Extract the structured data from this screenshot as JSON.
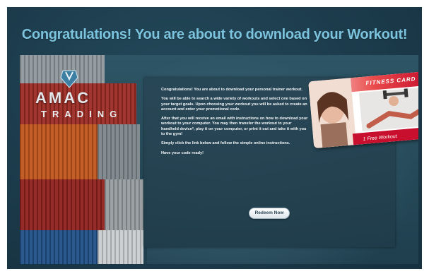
{
  "page": {
    "headline": "Congratulations! You are about to download your Workout!"
  },
  "logo": {
    "name": "AMAC",
    "subtitle": "TRADING"
  },
  "card": {
    "title": "FITNESS CARD",
    "footer": "1 Free Workout"
  },
  "content": {
    "paragraphs": [
      "Congratulations! You are about to download your personal trainer workout.",
      "You will be able to search a wide variety of workouts and select one based on your target goals. Upon choosing your workout you will be asked to create an account and enter your promotional code.",
      "After that you will receive an email with instructions on how to download your workout to your computer. You may then transfer the workout to your handheld device*, play it on your computer, or print it out and take it with you to the gym!",
      "Simply click the link below and follow the simple online instructions.",
      "Have your code ready!"
    ],
    "redeem_label": "Redeem Now"
  },
  "colors": {
    "headline": "#7cc3de",
    "background": "#1b3a4a",
    "card_red": "#c8102e"
  }
}
